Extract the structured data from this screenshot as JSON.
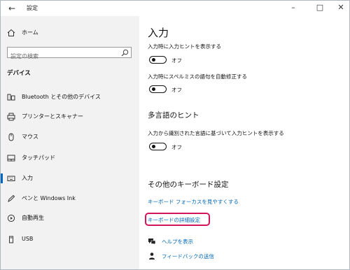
{
  "window": {
    "title": "設定",
    "back_icon": "back-arrow-icon",
    "controls": [
      "minimize-icon",
      "maximize-icon",
      "close-icon"
    ]
  },
  "sidebar": {
    "home_label": "ホーム",
    "search_placeholder": "設定の検索",
    "section_heading": "デバイス",
    "items": [
      {
        "label": "Bluetooth とその他のデバイス",
        "icon": "bluetooth-devices-icon"
      },
      {
        "label": "プリンターとスキャナー",
        "icon": "printer-icon"
      },
      {
        "label": "マウス",
        "icon": "mouse-icon"
      },
      {
        "label": "タッチパッド",
        "icon": "touchpad-icon"
      },
      {
        "label": "入力",
        "icon": "keyboard-icon",
        "active": true
      },
      {
        "label": "ペンと Windows Ink",
        "icon": "pen-icon"
      },
      {
        "label": "自動再生",
        "icon": "autoplay-icon"
      },
      {
        "label": "USB",
        "icon": "usb-icon"
      }
    ],
    "accent_color": "#0067c0"
  },
  "main": {
    "title": "入力",
    "options": [
      {
        "label": "入力時に入力ヒントを表示する",
        "state": "オフ"
      },
      {
        "label": "入力時にスペルミスの語句を自動修正する",
        "state": "オフ"
      }
    ],
    "multilingual": {
      "heading": "多言語のヒント",
      "option": {
        "label": "入力から識別された言語に基づいて入力ヒントを表示する",
        "state": "オフ"
      }
    },
    "keyboard_settings": {
      "heading": "その他のキーボード設定",
      "links": [
        "キーボード フォーカスを見やすくする",
        "キーボードの詳細設定"
      ],
      "highlight_color": "#d4145a"
    },
    "help": {
      "help_label": "ヘルプを表示",
      "feedback_label": "フィードバックの送信"
    },
    "link_color": "#0067b8"
  }
}
